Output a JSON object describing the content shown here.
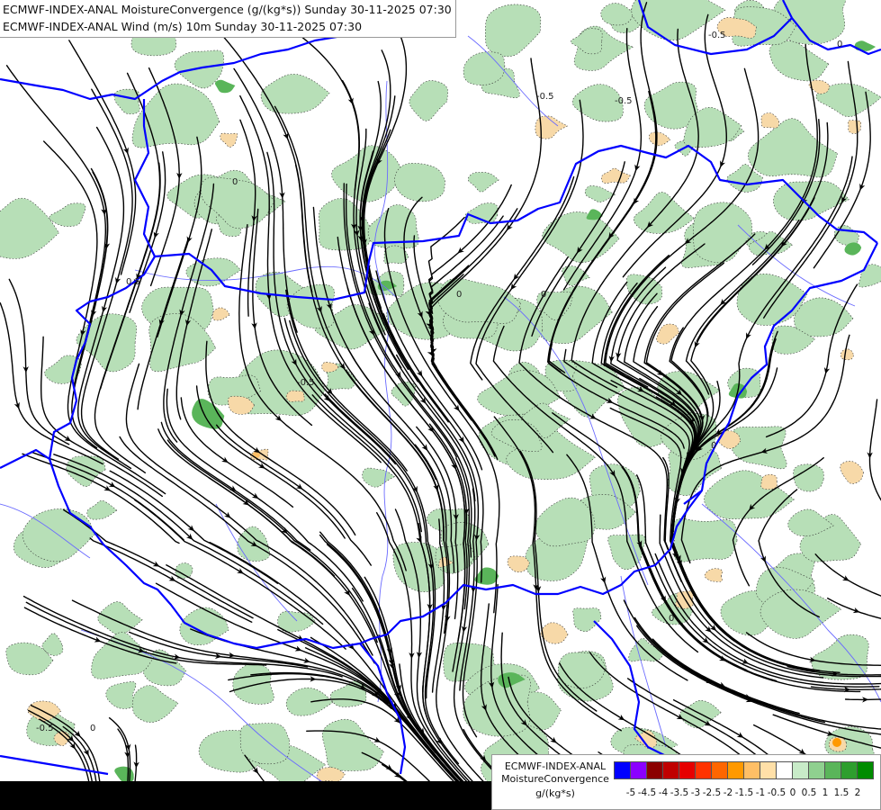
{
  "header": {
    "line1": "ECMWF-INDEX-ANAL MoistureConvergence (g/(kg*s)) Sunday 30-11-2025 07:30",
    "line2": "ECMWF-INDEX-ANAL Wind (m/s) 10m Sunday 30-11-2025 07:30"
  },
  "contour_labels": [
    "-0.5",
    "0",
    "0.5"
  ],
  "legend": {
    "title_line1": "ECMWF-INDEX-ANAL",
    "title_line2": "MoistureConvergence",
    "units": "g/(kg*s)",
    "colors": [
      "#0000ff",
      "#8b00ff",
      "#8b0000",
      "#c00000",
      "#e60000",
      "#ff3300",
      "#ff6600",
      "#ff9900",
      "#ffbf66",
      "#ffe0a8",
      "#ffffff",
      "#c8ebc8",
      "#8fd08f",
      "#5ab55a",
      "#2e9e2e",
      "#008c00"
    ],
    "ticks": [
      "-5",
      "-4.5",
      "-4",
      "-3.5",
      "-3",
      "-2.5",
      "-2",
      "-1.5",
      "-1",
      "-0.5",
      "0",
      "0.5",
      "1",
      "1.5",
      "2"
    ]
  },
  "colors": {
    "convergence_fill": "#b7dfb7",
    "convergence_strong": "#5ab55a",
    "divergence_fill": "#f7d9a8",
    "border": "#0000ff",
    "river": "#6b6bff",
    "streamline": "#000000"
  }
}
